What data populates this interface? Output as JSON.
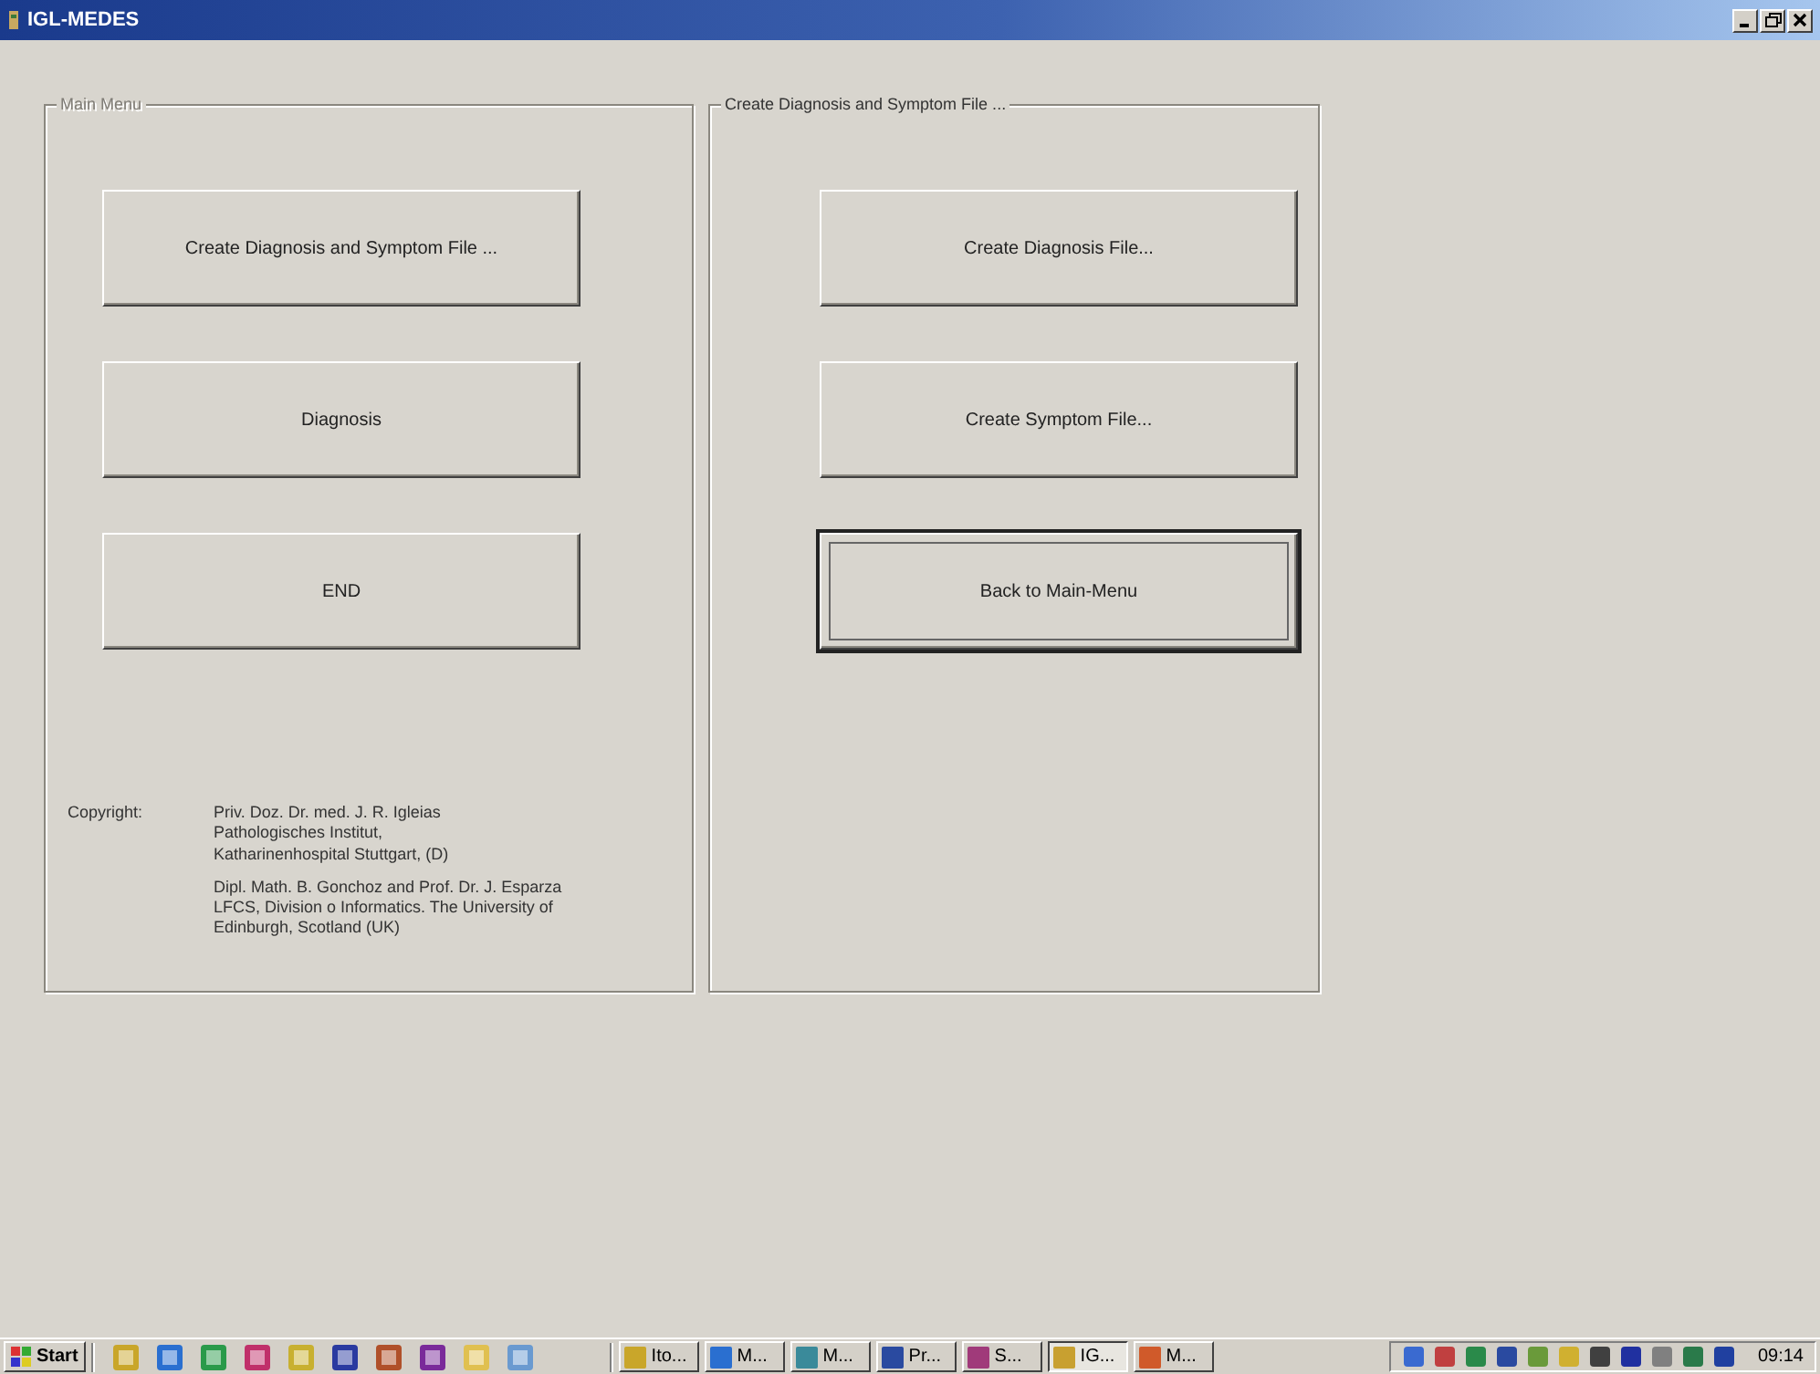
{
  "window": {
    "title": "IGL-MEDES"
  },
  "groups": [
    {
      "label": "Main Menu",
      "disabled": true,
      "buttons": [
        {
          "label": "Create Diagnosis and Symptom File ...",
          "focused": false
        },
        {
          "label": "Diagnosis",
          "focused": false
        },
        {
          "label": "END",
          "focused": false
        }
      ],
      "copyright": {
        "label": "Copyright:",
        "paragraphs": [
          "Priv. Doz. Dr. med. J. R. Igleias\nPathologisches Institut,\nKatharinenhospital Stuttgart, (D)",
          "Dipl. Math. B. Gonchoz and Prof. Dr. J. Esparza\nLFCS, Division o Informatics. The University of\nEdinburgh, Scotland (UK)"
        ]
      }
    },
    {
      "label": "Create Diagnosis and Symptom File ...",
      "disabled": false,
      "buttons": [
        {
          "label": "Create Diagnosis File...",
          "focused": false
        },
        {
          "label": "Create Symptom File...",
          "focused": false
        },
        {
          "label": "Back to Main-Menu",
          "focused": true
        }
      ]
    }
  ],
  "taskbar": {
    "start": "Start",
    "tasks": [
      {
        "label": "Ito...",
        "selected": false
      },
      {
        "label": "M...",
        "selected": false
      },
      {
        "label": "M...",
        "selected": false
      },
      {
        "label": "Pr...",
        "selected": false
      },
      {
        "label": "S...",
        "selected": false
      },
      {
        "label": "IG...",
        "selected": true
      },
      {
        "label": "M...",
        "selected": false
      }
    ],
    "clock": "09:14"
  }
}
